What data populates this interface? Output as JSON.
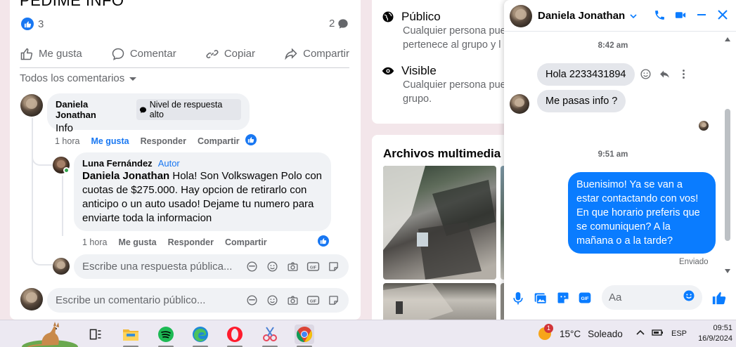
{
  "post": {
    "title": "PEDIME INFO",
    "like_count": "3",
    "comment_count": "2",
    "actions": {
      "like": "Me gusta",
      "comment": "Comentar",
      "copy": "Copiar",
      "share": "Compartir"
    },
    "comments_filter": "Todos los comentarios",
    "comments": [
      {
        "author": "Daniela Jonathan",
        "badge": "Nivel de respuesta alto",
        "text": "Info",
        "time": "1 hora",
        "like": "Me gusta",
        "reply": "Responder",
        "share": "Compartir"
      },
      {
        "author": "Luna Fernández",
        "author_tag": "Autor",
        "mention": "Daniela Jonathan",
        "text": " Hola! Son Volkswagen Polo con cuotas de $275.000. Hay opcion de retirarlo con anticipo o un auto usado! Dejame tu numero para enviarte toda la informacion",
        "time": "1 hora",
        "like": "Me gusta",
        "reply": "Responder",
        "share": "Compartir"
      }
    ],
    "reply_placeholder": "Escribe una respuesta pública...",
    "comment_placeholder": "Escribe un comentario público..."
  },
  "about": {
    "public_title": "Público",
    "public_desc_1": "Cualquier persona pue",
    "public_desc_2": "pertenece al grupo y l",
    "visible_title": "Visible",
    "visible_desc_1": "Cualquier persona pue",
    "visible_desc_2": "grupo."
  },
  "media": {
    "title": "Archivos multimedia re"
  },
  "chat": {
    "contact_name": "Daniela Jonathan",
    "messages": {
      "time_1": "8:42 am",
      "in_1": "Hola 2233431894",
      "in_2": "Me pasas info ?",
      "time_2": "9:51 am",
      "out_1": "Buenisimo! Ya se van a estar contactando con vos! En que horario preferis que se comuniquen? A la mañana o a la tarde?",
      "status": "Enviado"
    },
    "input_placeholder": "Aa"
  },
  "taskbar": {
    "notification_count": "1",
    "temperature": "15°C",
    "weather": "Soleado",
    "language": "ESP",
    "time": "09:51",
    "date": "16/9/2024"
  },
  "colors": {
    "brand_blue": "#1877f2",
    "messenger_blue": "#0a7cff"
  }
}
